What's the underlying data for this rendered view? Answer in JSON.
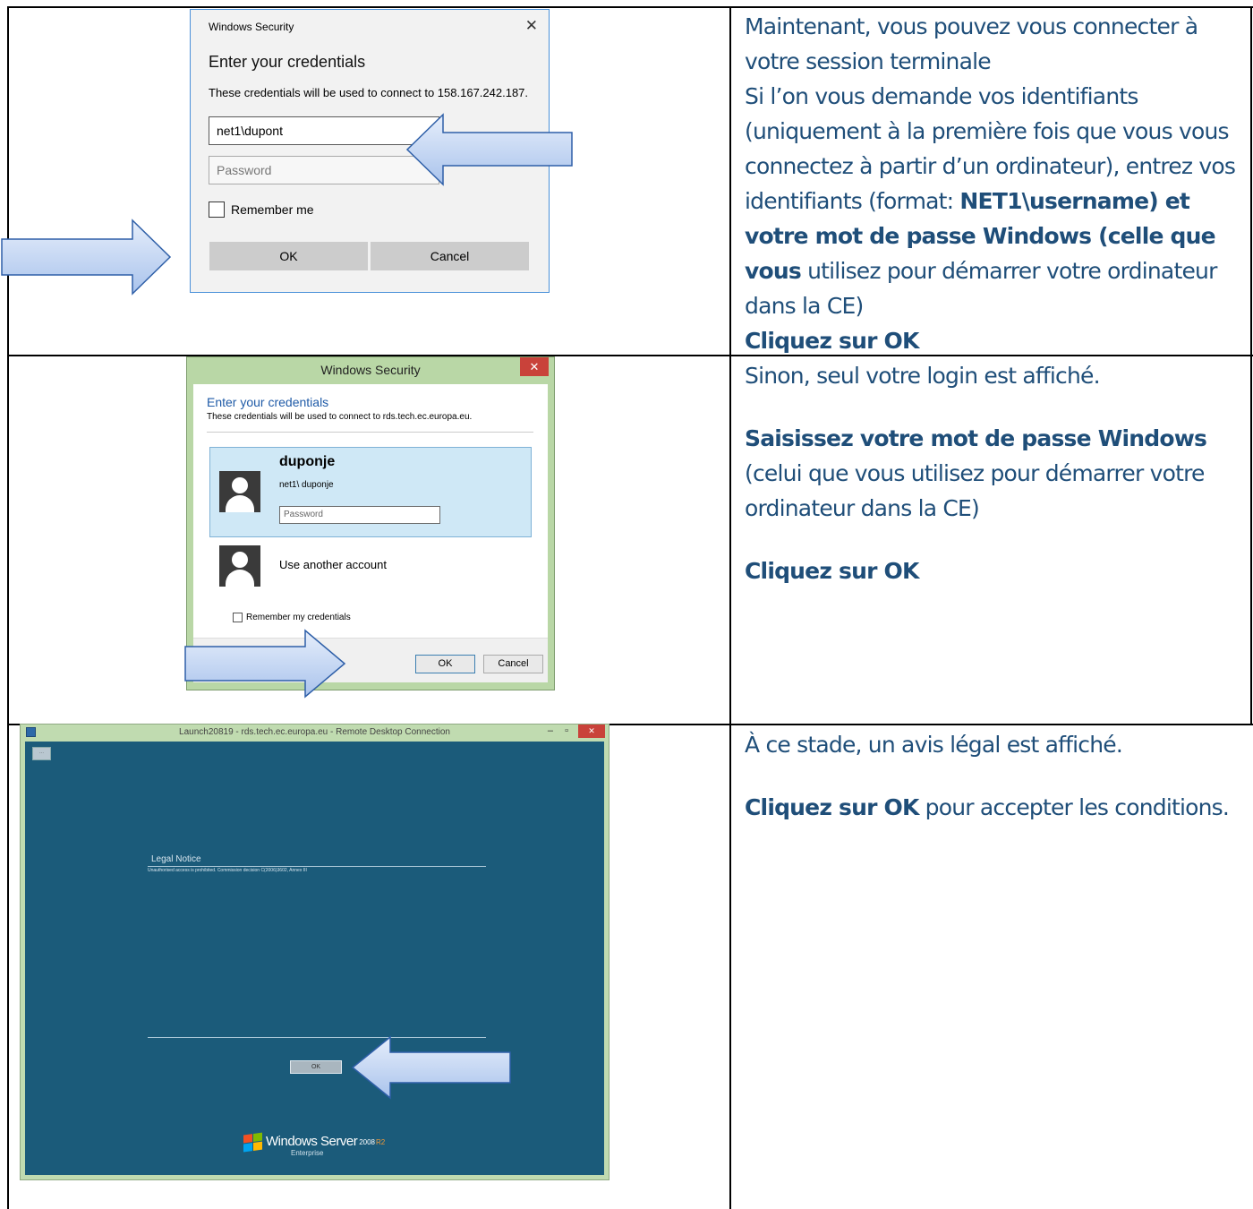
{
  "row1": {
    "dialog": {
      "title": "Windows Security",
      "close": "✕",
      "heading": "Enter your credentials",
      "description": "These credentials will be used to connect to 158.167.242.187.",
      "username_value": "net1\\dupont",
      "password_placeholder": "Password",
      "remember_label": "Remember me",
      "ok_label": "OK",
      "cancel_label": "Cancel"
    },
    "text": {
      "l1": "Maintenant, vous pouvez vous connecter à votre session terminale",
      "l2": "Si l’on vous demande vos identifiants (uniquement à la première fois que vous vous connectez à partir d’un ordinateur), entrez vos identifiants (format: ",
      "l2_bold": "NET1\\username) et votre mot de passe Windows (celle que vous",
      "l2_end": " utilisez pour démarrer votre ordinateur dans la CE)",
      "l3": "Cliquez sur OK"
    }
  },
  "row2": {
    "dialog": {
      "title": "Windows Security",
      "close": "✕",
      "heading": "Enter your credentials",
      "description": "These credentials will be used to connect to rds.tech.ec.europa.eu.",
      "account_name": "duponje",
      "account_login": "net1\\ duponje",
      "password_placeholder": "Password",
      "other_account": "Use another account",
      "remember_label": "Remember my credentials",
      "ok_label": "OK",
      "cancel_label": "Cancel"
    },
    "text": {
      "l1": "Sinon, seul votre login est affiché.",
      "l2_bold": "Saisissez votre mot de passe Windows",
      "l2_rest": " (celui que vous utilisez pour démarrer votre ordinateur dans la CE)",
      "l3": "Cliquez sur OK"
    }
  },
  "row3": {
    "window": {
      "title": "Launch20819 - rds.tech.ec.europa.eu - Remote Desktop Connection",
      "controls": "–  ▫",
      "close": "✕",
      "legal_title": "Legal Notice",
      "legal_text": "Unauthorised access is prohibited. Commission decision C(2006)3602, Annex III",
      "ok_label": "OK",
      "brand": "Windows Server",
      "brand_version": "2008",
      "brand_r2": "R2",
      "edition": "Enterprise"
    },
    "text": {
      "l1": "À ce stade, un avis légal est affiché.",
      "l2_bold": "Cliquez sur OK",
      "l2_rest": " pour accepter les conditions."
    }
  },
  "colors": {
    "text": "#1f4e79",
    "arrow_fill": "#c6d8f4",
    "arrow_stroke": "#2e5fa8",
    "rdp_screen": "#1b5b7a"
  }
}
